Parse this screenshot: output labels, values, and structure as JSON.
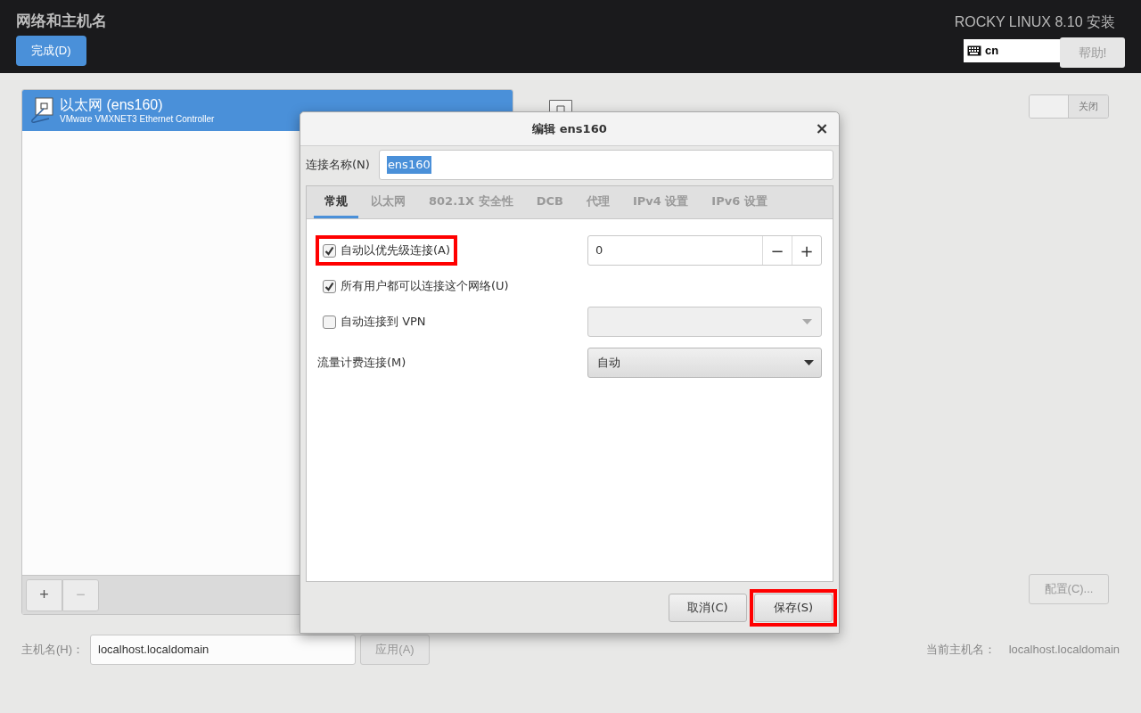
{
  "header": {
    "title": "网络和主机名",
    "done_button": "完成(D)",
    "product": "ROCKY LINUX 8.10 安装",
    "keyboard_layout": "cn",
    "help_button": "帮助!"
  },
  "devices": [
    {
      "name": "以太网 (ens160)",
      "description": "VMware VMXNET3 Ethernet Controller",
      "selected": true
    }
  ],
  "device_buttons": [
    {
      "label": "+",
      "disabled": false
    },
    {
      "label": "−",
      "disabled": true
    }
  ],
  "detail": {
    "switch": {
      "label": "关闭",
      "on": false
    },
    "configure_button": "配置(C)..."
  },
  "hostname": {
    "label": "主机名(H)：",
    "value": "localhost.localdomain",
    "apply_button": "应用(A)",
    "current_label": "当前主机名：",
    "current_value": "localhost.localdomain"
  },
  "dialog": {
    "title": "编辑 ens160",
    "close": "×",
    "connection_name_label": "连接名称(N)",
    "connection_name": "ens160",
    "tabs": [
      {
        "label": "常规",
        "selected": true
      },
      {
        "label": "以太网",
        "selected": false
      },
      {
        "label": "802.1X 安全性",
        "selected": false
      },
      {
        "label": "DCB",
        "selected": false
      },
      {
        "label": "代理",
        "selected": false
      },
      {
        "label": "IPv4 设置",
        "selected": false
      },
      {
        "label": "IPv6 设置",
        "selected": false
      }
    ],
    "options": [
      {
        "kind": "checkbox",
        "label": "自动以优先级连接(A)",
        "checked": true,
        "highlighted": true,
        "spin": {
          "value": "0",
          "minus": "−",
          "plus": "+"
        }
      },
      {
        "kind": "checkbox",
        "label": "所有用户都可以连接这个网络(U)",
        "checked": true,
        "highlighted": false
      },
      {
        "kind": "checkbox",
        "label": "自动连接到 VPN",
        "checked": false,
        "highlighted": false,
        "dropdown": {
          "disabled": true
        }
      },
      {
        "kind": "select",
        "label": "流量计费连接(M)",
        "value": "自动"
      }
    ],
    "buttons": [
      {
        "label": "取消(C)",
        "highlighted": false
      },
      {
        "label": "保存(S)",
        "highlighted": true
      }
    ]
  }
}
